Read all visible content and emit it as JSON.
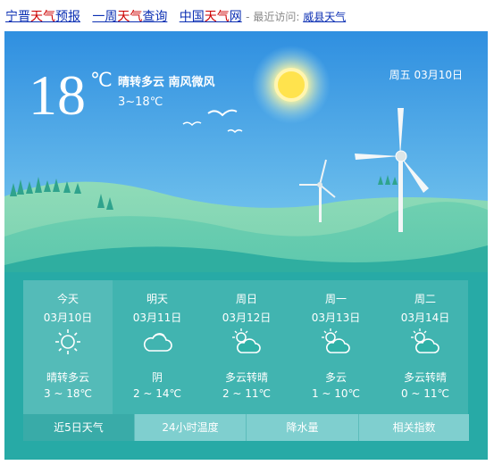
{
  "topbar": {
    "link1_a": "宁晋",
    "link1_b": "天气",
    "link1_c": "预报",
    "link2_a": "一周",
    "link2_b": "天气",
    "link2_c": "查询",
    "link3_a": "中国",
    "link3_b": "天气",
    "link3_c": "网",
    "recent_label": " - 最近访问: ",
    "recent_link": "威县天气"
  },
  "now": {
    "temp": "18",
    "unit": "℃",
    "condition": "晴转多云 南风微风",
    "range": "3~18℃",
    "date": "周五 03月10日"
  },
  "days": [
    {
      "name": "今天",
      "date": "03月10日",
      "icon": "sun-icon",
      "cond": "晴转多云",
      "range": "3 ~ 18℃"
    },
    {
      "name": "明天",
      "date": "03月11日",
      "icon": "cloud-icon",
      "cond": "阴",
      "range": "2 ~ 14℃"
    },
    {
      "name": "周日",
      "date": "03月12日",
      "icon": "partly-cloudy-icon",
      "cond": "多云转晴",
      "range": "2 ~ 11℃"
    },
    {
      "name": "周一",
      "date": "03月13日",
      "icon": "partly-cloudy-icon",
      "cond": "多云",
      "range": "1 ~ 10℃"
    },
    {
      "name": "周二",
      "date": "03月14日",
      "icon": "partly-cloudy-icon",
      "cond": "多云转晴",
      "range": "0 ~ 11℃"
    }
  ],
  "tabs": [
    "近5日天气",
    "24小时温度",
    "降水量",
    "相关指数"
  ],
  "colors": {
    "sky_top": "#2f8fe0",
    "sky_bottom": "#aee6f0",
    "hill": "#5cc6a6",
    "ground": "#2ab0a8",
    "link": "#0b2fb3",
    "accent": "#cc0000"
  }
}
